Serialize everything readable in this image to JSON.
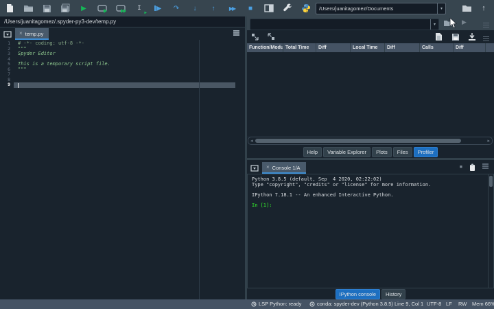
{
  "icons": {
    "run": "▶",
    "step_over": "↷",
    "step_into": "↓",
    "step_out": "↑",
    "continue": "▶▶",
    "stop": "■",
    "ibeam": "I",
    "mini_run": "▶",
    "up_arrow": "↑",
    "dropdown": "▾",
    "play_small": "▶",
    "close": "×",
    "scroll_left": "◂",
    "scroll_right": "▸",
    "square_stop": "■"
  },
  "colors": {
    "bg": "#19232D",
    "toolbar": "#37454F",
    "header_gray": "#455364",
    "selected_blue": "#1D6FC0",
    "tab_underline": "#3E8FD6",
    "run_green": "#15B857",
    "debug_blue": "#4B9FE1",
    "prompt_green": "#2DB92D"
  },
  "toolbar": {
    "cwd_value": "/Users/juanitagomez/Documents"
  },
  "editor": {
    "path": "/Users/juanitagomez/.spyder-py3-dev/temp.py",
    "tab_label": "temp.py",
    "lines": [
      {
        "num": "1",
        "text": "# -*- coding: utf-8 -*-"
      },
      {
        "num": "2",
        "text": "\"\"\""
      },
      {
        "num": "3",
        "text": "Spyder Editor"
      },
      {
        "num": "4",
        "text": ""
      },
      {
        "num": "5",
        "text": "This is a temporary script file."
      },
      {
        "num": "6",
        "text": "\"\"\""
      },
      {
        "num": "7",
        "text": ""
      },
      {
        "num": "8",
        "text": ""
      },
      {
        "num": "9",
        "text": ""
      }
    ]
  },
  "profiler": {
    "columns": [
      "Function/Modu",
      "Total Time",
      "Diff",
      "Local Time",
      "Diff",
      "Calls",
      "Diff"
    ]
  },
  "pane_tabs": {
    "labels": [
      "Help",
      "Variable Explorer",
      "Plots",
      "Files",
      "Profiler"
    ],
    "selected": "Profiler"
  },
  "console": {
    "tab_label": "Console 1/A",
    "banner_line1": "Python 3.8.5 (default, Sep  4 2020, 02:22:02)",
    "banner_line2": "Type \"copyright\", \"credits\" or \"license\" for more information.",
    "banner_line3": "IPython 7.18.1 -- An enhanced Interactive Python.",
    "prompt": "In [1]:"
  },
  "bottom_tabs": {
    "labels": [
      "IPython console",
      "History"
    ],
    "selected": "IPython console"
  },
  "statusbar": {
    "lsp": "LSP Python: ready",
    "conda": "conda: spyder-dev (Python 3.8.5)",
    "cursor_pos": "Line 9, Col 1",
    "encoding": "UTF-8",
    "eol": "LF",
    "rw": "RW",
    "mem": "Mem 66%"
  }
}
